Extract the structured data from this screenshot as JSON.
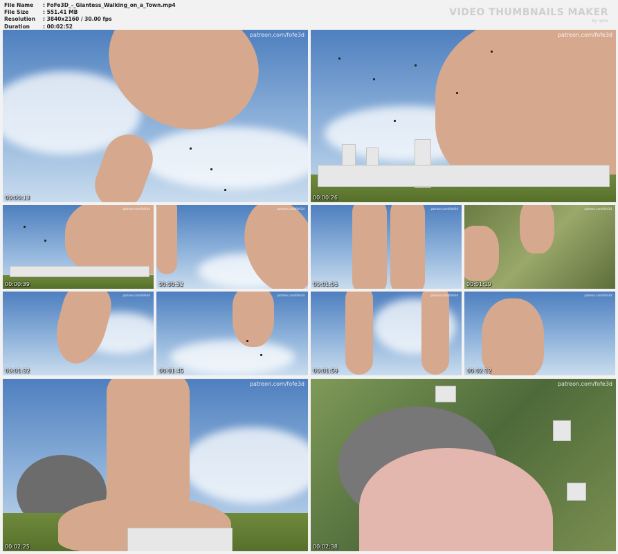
{
  "info": {
    "rows": [
      {
        "label": "File Name",
        "value": "FoFe3D_-_Giantess_Walking_on_a_Town.mp4"
      },
      {
        "label": "File Size",
        "value": "551.41 MB"
      },
      {
        "label": "Resolution",
        "value": "3840x2160 / 30.00 fps"
      },
      {
        "label": "Duration",
        "value": "00:02:52"
      }
    ],
    "separator": ":"
  },
  "brand": {
    "title": "VIDEO THUMBNAILS MAKER",
    "subtitle": "By Iqilla"
  },
  "watermark": "patreon.com/fofe3d",
  "thumbnails": [
    {
      "timestamp": "00:00:13",
      "scene": "foot-sky"
    },
    {
      "timestamp": "00:00:26",
      "scene": "foot-city"
    },
    {
      "timestamp": "00:00:39",
      "scene": "foot-city-small"
    },
    {
      "timestamp": "00:00:52",
      "scene": "legs-sky"
    },
    {
      "timestamp": "00:01:06",
      "scene": "legs-back"
    },
    {
      "timestamp": "00:01:19",
      "scene": "foot-ground"
    },
    {
      "timestamp": "00:01:32",
      "scene": "heel-sky"
    },
    {
      "timestamp": "00:01:45",
      "scene": "sole-sky"
    },
    {
      "timestamp": "00:01:59",
      "scene": "legs-person"
    },
    {
      "timestamp": "00:02:12",
      "scene": "sole-toes"
    },
    {
      "timestamp": "00:02:25",
      "scene": "feet-city-smoke"
    },
    {
      "timestamp": "00:02:38",
      "scene": "foot-top-smoke"
    }
  ],
  "colors": {
    "background": "#f2f2f2",
    "sky": "#6d98c8",
    "skin": "#d6a98f",
    "nail_polish": "#1f6fa8"
  }
}
